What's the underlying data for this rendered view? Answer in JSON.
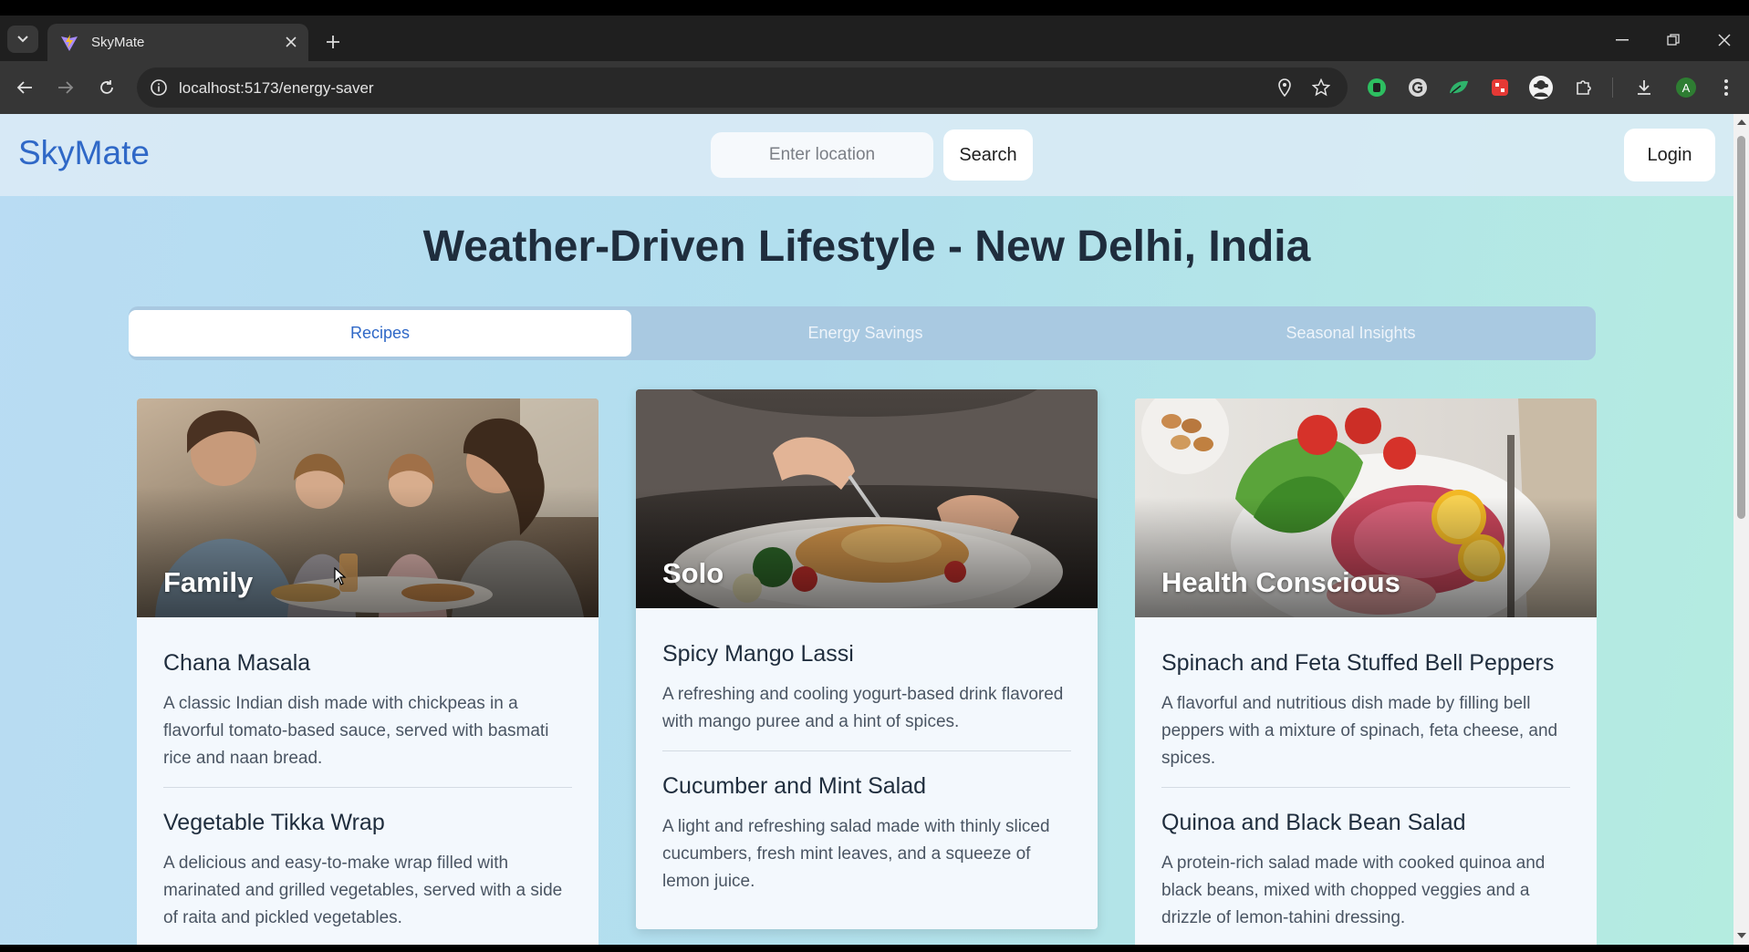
{
  "browser": {
    "tab_title": "SkyMate",
    "url": "localhost:5173/energy-saver",
    "profile_initial": "A"
  },
  "header": {
    "brand": "SkyMate",
    "location_placeholder": "Enter location",
    "search_label": "Search",
    "login_label": "Login"
  },
  "page": {
    "title": "Weather-Driven Lifestyle - New Delhi, India"
  },
  "tabs": [
    {
      "label": "Recipes",
      "active": true
    },
    {
      "label": "Energy Savings",
      "active": false
    },
    {
      "label": "Seasonal Insights",
      "active": false
    }
  ],
  "cards": [
    {
      "label": "Family",
      "recipes": [
        {
          "title": "Chana Masala",
          "description": "A classic Indian dish made with chickpeas in a flavorful tomato-based sauce, served with basmati rice and naan bread."
        },
        {
          "title": "Vegetable Tikka Wrap",
          "description": "A delicious and easy-to-make wrap filled with marinated and grilled vegetables, served with a side of raita and pickled vegetables."
        }
      ]
    },
    {
      "label": "Solo",
      "recipes": [
        {
          "title": "Spicy Mango Lassi",
          "description": "A refreshing and cooling yogurt-based drink flavored with mango puree and a hint of spices."
        },
        {
          "title": "Cucumber and Mint Salad",
          "description": "A light and refreshing salad made with thinly sliced cucumbers, fresh mint leaves, and a squeeze of lemon juice."
        }
      ]
    },
    {
      "label": "Health Conscious",
      "recipes": [
        {
          "title": "Spinach and Feta Stuffed Bell Peppers",
          "description": "A flavorful and nutritious dish made by filling bell peppers with a mixture of spinach, feta cheese, and spices."
        },
        {
          "title": "Quinoa and Black Bean Salad",
          "description": "A protein-rich salad made with cooked quinoa and black beans, mixed with chopped veggies and a drizzle of lemon-tahini dressing."
        }
      ]
    }
  ],
  "colors": {
    "brand": "#2f68c7",
    "tab_active_text": "#2f68c7",
    "title_text": "#1f2d3d"
  }
}
